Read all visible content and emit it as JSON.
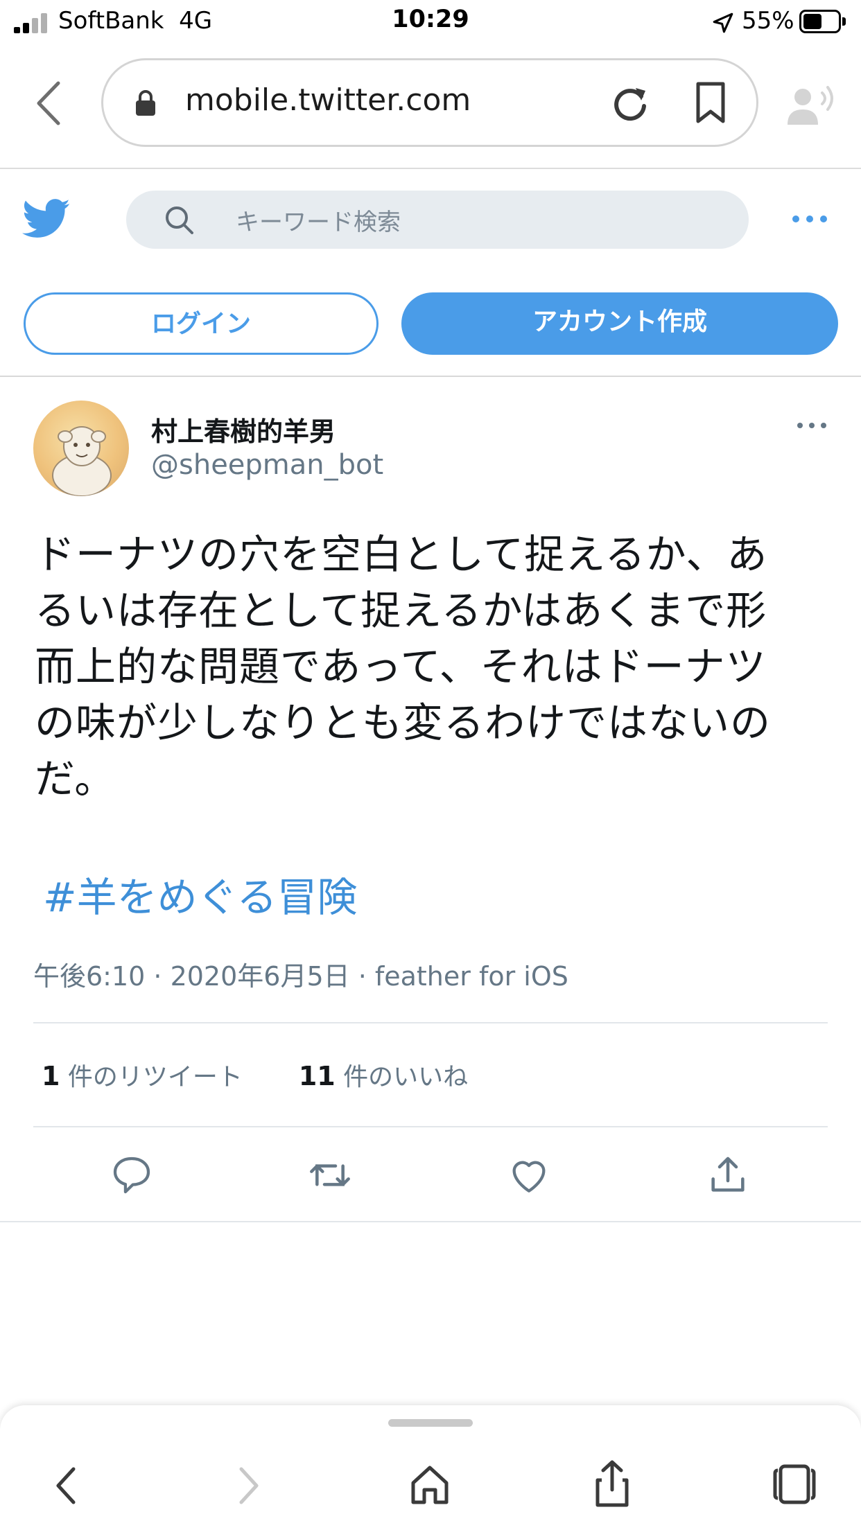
{
  "status_bar": {
    "carrier": "SoftBank",
    "network": "4G",
    "time": "10:29",
    "battery_percent": "55%",
    "battery_level": 0.55
  },
  "browser": {
    "url": "mobile.twitter.com"
  },
  "twitter": {
    "search_placeholder": "キーワード検索",
    "login_label": "ログイン",
    "signup_label": "アカウント作成",
    "brand_color": "#4a9ce8"
  },
  "tweet": {
    "display_name": "村上春樹的羊男",
    "handle": "@sheepman_bot",
    "text_lines": [
      "ドーナツの穴を空白として捉えるか、あ",
      "るいは存在として捉えるかはあくまで形",
      "而上的な問題であって、それはドーナツ",
      "の味が少しなりとも変るわけではないの",
      "だ。"
    ],
    "hashtag": "#羊をめぐる冒険",
    "meta": "午後6:10 · 2020年6月5日 · feather for iOS",
    "retweet_count": "1",
    "retweet_label": "件のリツイート",
    "like_count": "11",
    "like_label": "件のいいね"
  }
}
